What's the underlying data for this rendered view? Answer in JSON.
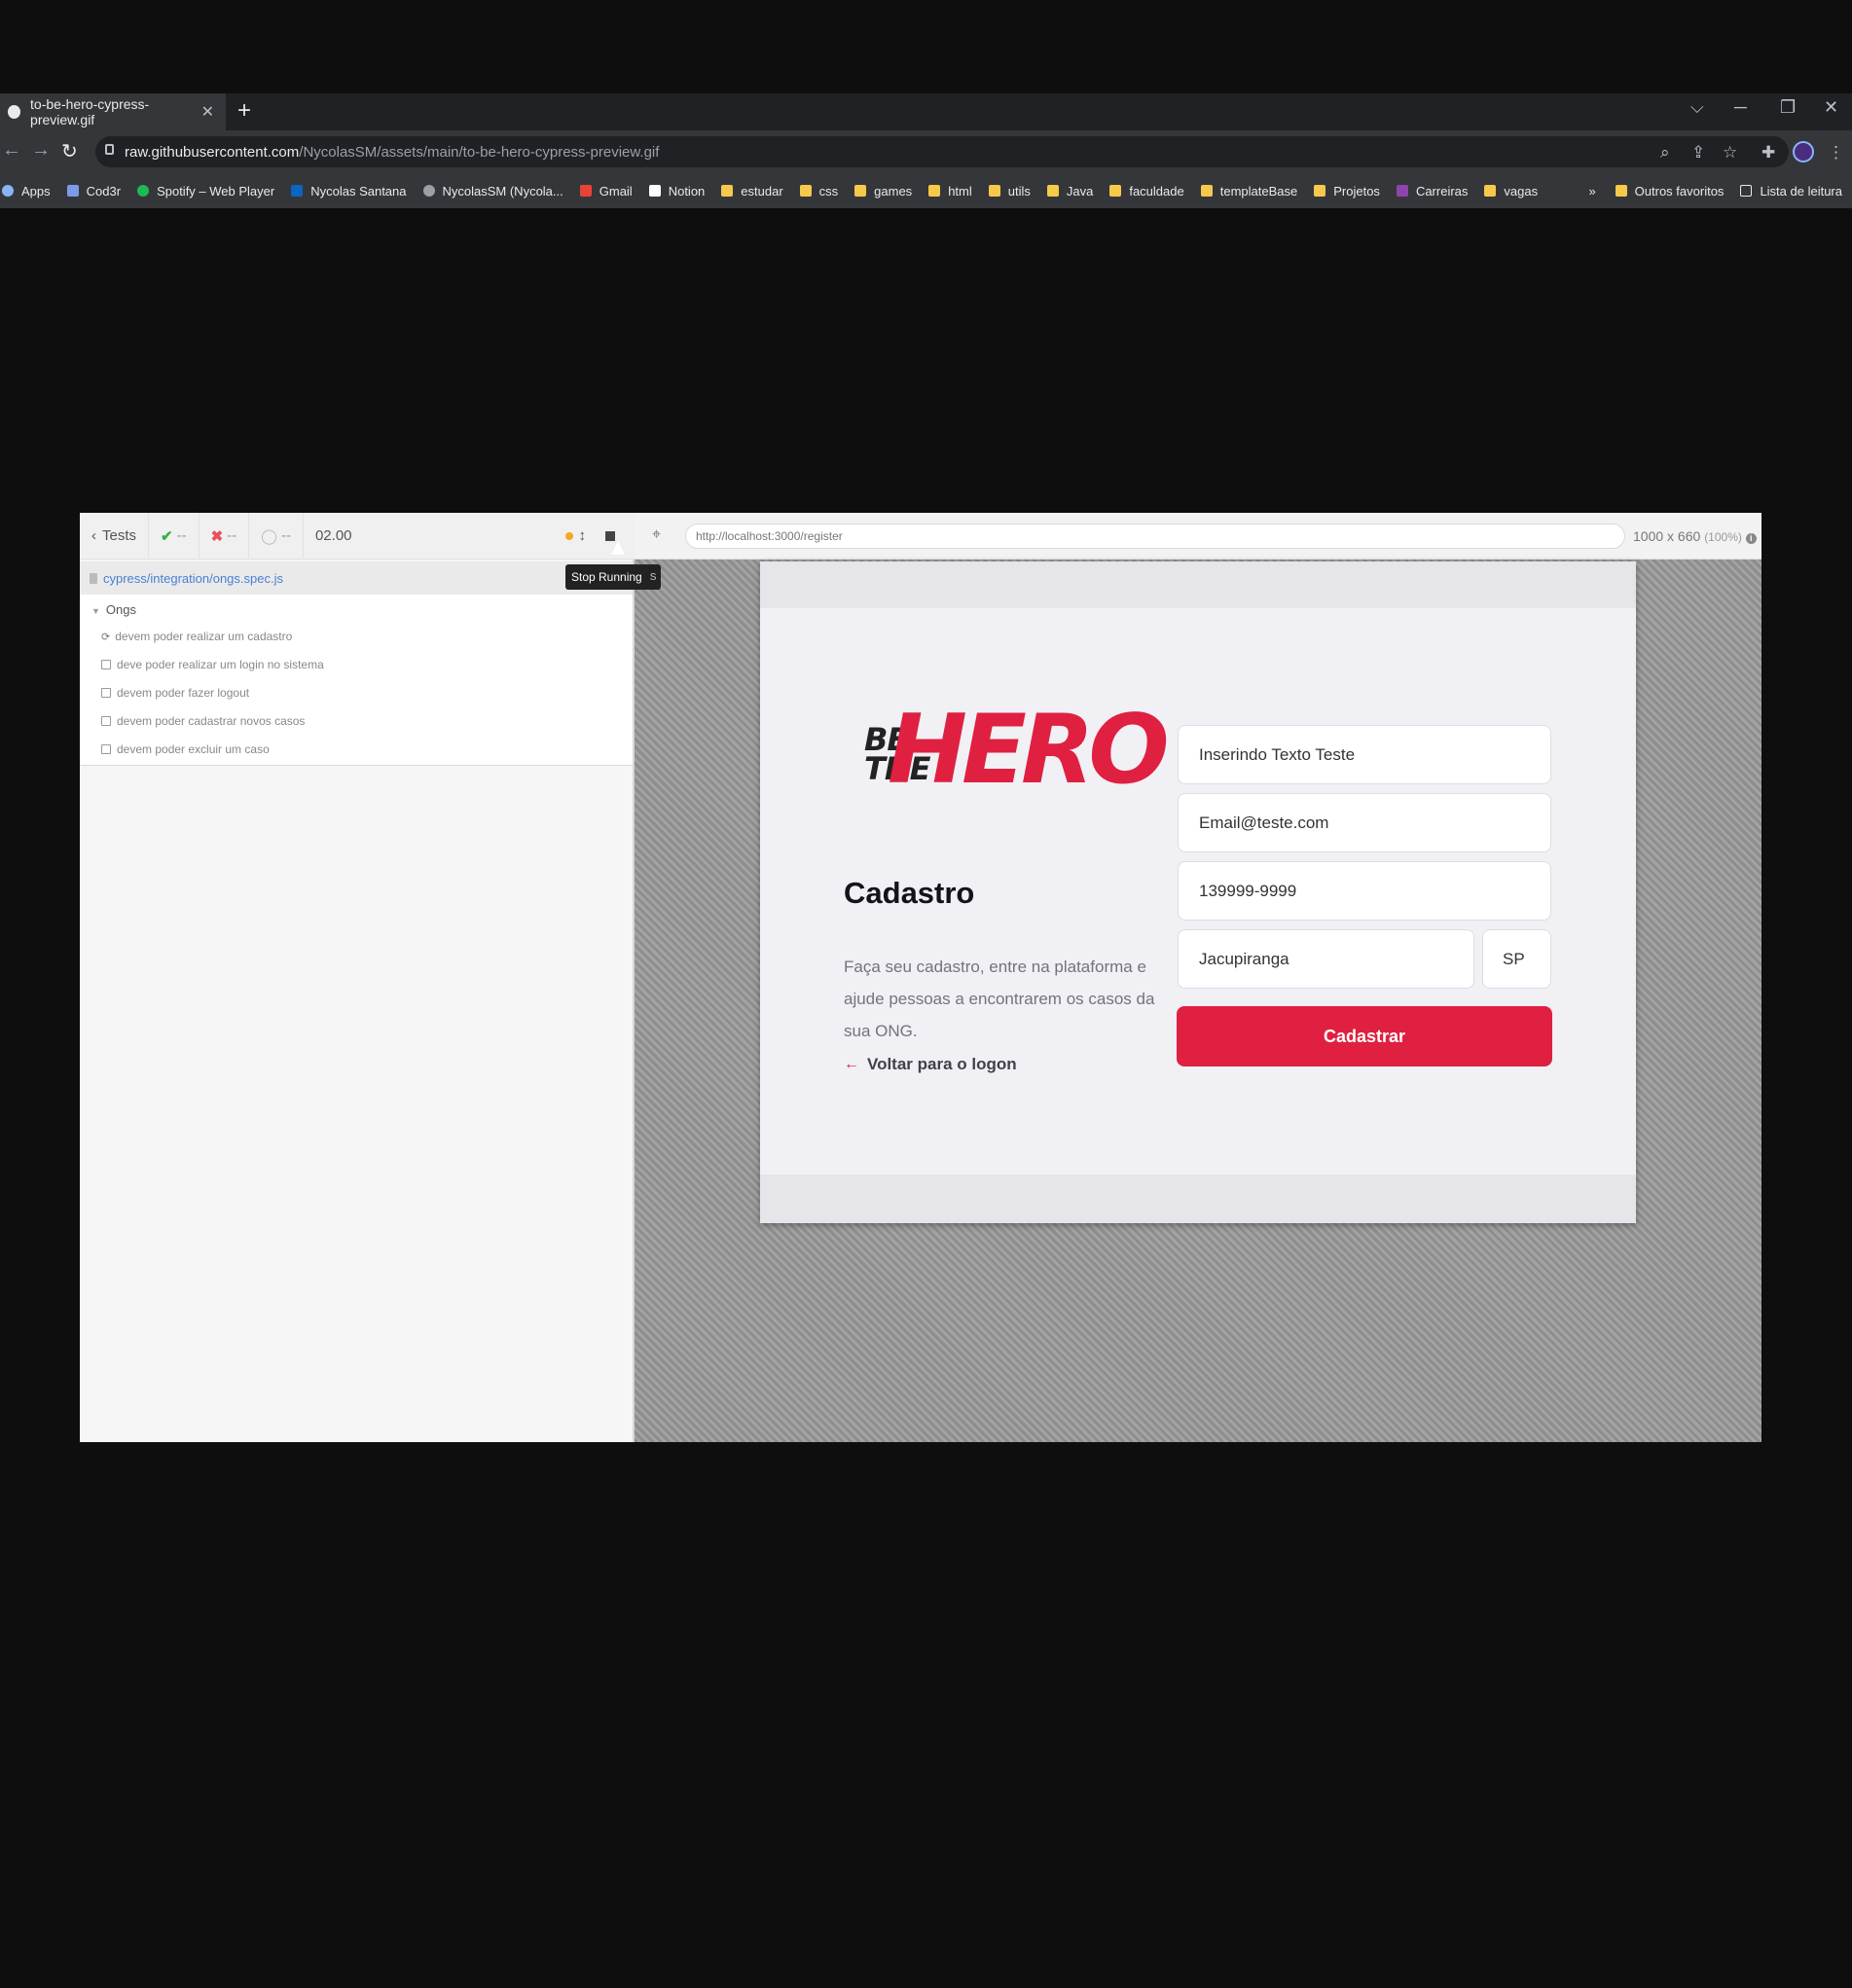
{
  "browser": {
    "tab_title": "to-be-hero-cypress-preview.gif",
    "tab_close": "✕",
    "new_tab": "+",
    "url_host": "raw.githubusercontent.com",
    "url_path": "/NycolasSM/assets/main/to-be-hero-cypress-preview.gif",
    "bookmarks": [
      {
        "label": "Apps",
        "icon": "apps-grid-icon",
        "color": "#8ab4f8"
      },
      {
        "label": "Cod3r",
        "icon": "cod3r-icon",
        "color": "#7b9be6"
      },
      {
        "label": "Spotify – Web Player",
        "icon": "spotify-icon",
        "color": "#1db954"
      },
      {
        "label": "Nycolas Santana",
        "icon": "linkedin-icon",
        "color": "#0a66c2"
      },
      {
        "label": "NycolasSM (Nycola...",
        "icon": "github-icon",
        "color": "#9aa0a6"
      },
      {
        "label": "Gmail",
        "icon": "gmail-icon",
        "color": "#ea4335"
      },
      {
        "label": "Notion",
        "icon": "notion-icon",
        "color": "#ffffff"
      },
      {
        "label": "estudar",
        "icon": "folder-icon",
        "color": "#f6c94a"
      },
      {
        "label": "css",
        "icon": "folder-icon",
        "color": "#f6c94a"
      },
      {
        "label": "games",
        "icon": "folder-icon",
        "color": "#f6c94a"
      },
      {
        "label": "html",
        "icon": "folder-icon",
        "color": "#f6c94a"
      },
      {
        "label": "utils",
        "icon": "folder-icon",
        "color": "#f6c94a"
      },
      {
        "label": "Java",
        "icon": "folder-icon",
        "color": "#f6c94a"
      },
      {
        "label": "faculdade",
        "icon": "folder-icon",
        "color": "#f6c94a"
      },
      {
        "label": "templateBase",
        "icon": "folder-icon",
        "color": "#f6c94a"
      },
      {
        "label": "Projetos",
        "icon": "folder-icon",
        "color": "#f6c94a"
      },
      {
        "label": "Carreiras",
        "icon": "carreiras-icon",
        "color": "#8e44ad"
      },
      {
        "label": "vagas",
        "icon": "folder-icon",
        "color": "#f6c94a"
      }
    ],
    "more_bookmarks": "»",
    "other_favorites": "Outros favoritos",
    "reading_list": "Lista de leitura"
  },
  "cypress": {
    "tests_label": "Tests",
    "passed": "--",
    "failed": "--",
    "pending": "--",
    "duration": "02.00",
    "spec_file": "cypress/integration/ongs.spec.js",
    "suite_name": "Ongs",
    "tests": [
      "devem poder realizar um cadastro",
      "deve poder realizar um login no sistema",
      "devem poder fazer logout",
      "devem poder cadastrar novos casos",
      "devem poder excluir um caso"
    ],
    "tooltip": "Stop Running",
    "tooltip_key": "S",
    "aut_url": "http://localhost:3000/register",
    "viewport": "1000 x 660",
    "zoom": "(100%)"
  },
  "app": {
    "logo_be": "BE",
    "logo_the": "THE",
    "logo_hero": "HERO",
    "title": "Cadastro",
    "description": "Faça seu cadastro, entre na plataforma e ajude pessoas a encontrarem os casos da sua ONG.",
    "back_link": "Voltar para o logon",
    "fields": {
      "name": "Inserindo Texto Teste",
      "email": "Email@teste.com",
      "whatsapp": "139999-9999",
      "city": "Jacupiranga",
      "uf": "SP"
    },
    "submit": "Cadastrar",
    "accent": "#e02041"
  }
}
